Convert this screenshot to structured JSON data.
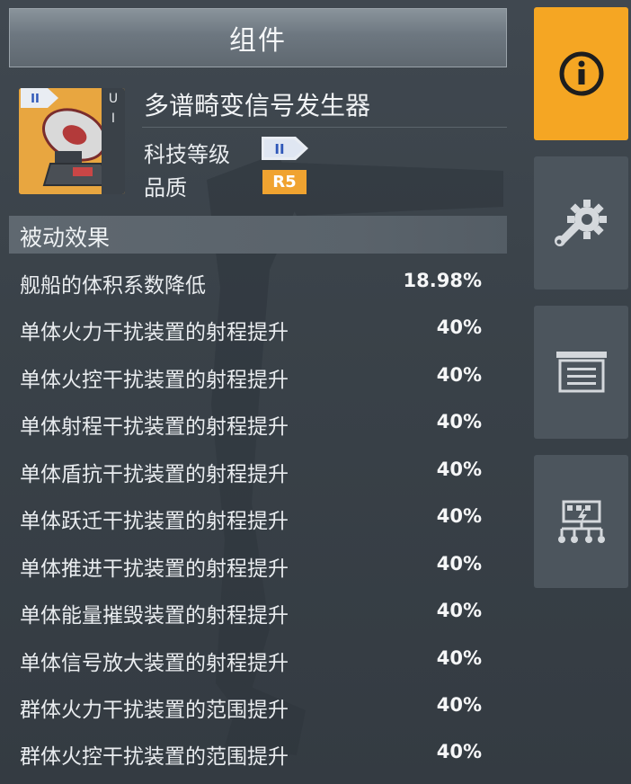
{
  "panel_title": "组件",
  "item": {
    "name": "多谱畸变信号发生器",
    "tier_badge": "II",
    "side_letters": [
      "U",
      "I"
    ],
    "tech_level_label": "科技等级",
    "tech_level_badge": "II",
    "quality_label": "品质",
    "quality_badge": "R5"
  },
  "section_title": "被动效果",
  "effects": [
    {
      "label": "舰船的体积系数降低",
      "value": "18.98%"
    },
    {
      "label": "单体火力干扰装置的射程提升",
      "value": "40%"
    },
    {
      "label": "单体火控干扰装置的射程提升",
      "value": "40%"
    },
    {
      "label": "单体射程干扰装置的射程提升",
      "value": "40%"
    },
    {
      "label": "单体盾抗干扰装置的射程提升",
      "value": "40%"
    },
    {
      "label": "单体跃迁干扰装置的射程提升",
      "value": "40%"
    },
    {
      "label": "单体推进干扰装置的射程提升",
      "value": "40%"
    },
    {
      "label": "单体能量摧毁装置的射程提升",
      "value": "40%"
    },
    {
      "label": "单体信号放大装置的射程提升",
      "value": "40%"
    },
    {
      "label": "群体火力干扰装置的范围提升",
      "value": "40%"
    },
    {
      "label": "群体火控干扰装置的范围提升",
      "value": "40%"
    }
  ],
  "tabs": [
    {
      "name": "info",
      "icon": "info-icon",
      "active": true
    },
    {
      "name": "modules",
      "icon": "gear-wrench-icon",
      "active": false
    },
    {
      "name": "list",
      "icon": "list-icon",
      "active": false
    },
    {
      "name": "tree",
      "icon": "network-icon",
      "active": false
    }
  ],
  "colors": {
    "accent": "#f5a623",
    "quality_badge": "#f0a330",
    "panel_bg": "#3a424a",
    "tab_bg": "#4c555d"
  }
}
